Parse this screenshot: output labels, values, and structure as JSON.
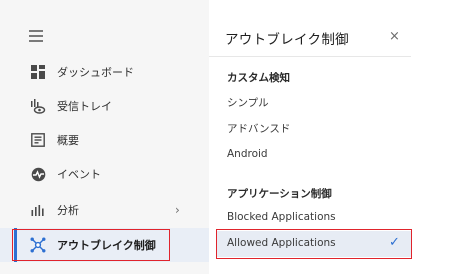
{
  "sidebar": {
    "items": [
      {
        "label": "ダッシュボード",
        "icon": "dashboard-icon"
      },
      {
        "label": "受信トレイ",
        "icon": "inbox-eye-icon"
      },
      {
        "label": "概要",
        "icon": "summary-icon"
      },
      {
        "label": "イベント",
        "icon": "event-icon"
      },
      {
        "label": "分析",
        "icon": "analytics-icon",
        "chevron": "›"
      },
      {
        "label": "アウトブレイク制御",
        "icon": "outbreak-icon"
      }
    ],
    "active_index": 5
  },
  "panel": {
    "title": "アウトブレイク制御",
    "close": "×",
    "sections": [
      {
        "heading": "カスタム検知",
        "options": [
          "シンプル",
          "アドバンスド",
          "Android"
        ]
      },
      {
        "heading": "アプリケーション制御",
        "options": [
          "Blocked Applications",
          "Allowed Applications"
        ]
      }
    ],
    "selected_option": "Allowed Applications",
    "check": "✓"
  },
  "colors": {
    "accent": "#2c6fd1",
    "highlight": "#e0242c",
    "sidebar_bg": "#f6f6f6"
  }
}
